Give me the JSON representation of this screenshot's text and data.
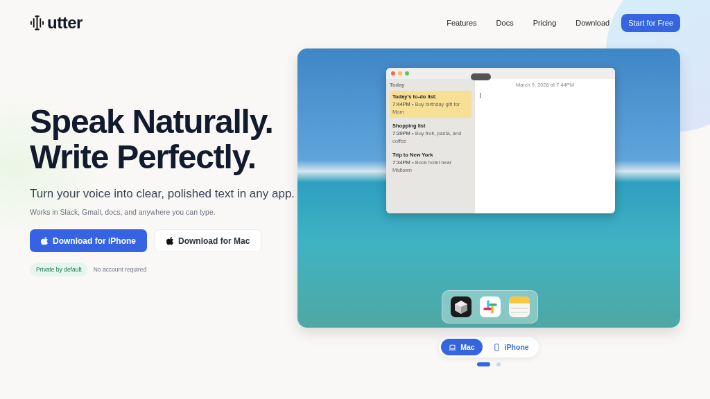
{
  "header": {
    "brand": "utter",
    "nav": [
      {
        "label": "Features"
      },
      {
        "label": "Docs"
      },
      {
        "label": "Pricing"
      },
      {
        "label": "Download"
      }
    ],
    "cta": "Start for Free"
  },
  "hero": {
    "title_lines": [
      "Speak Naturally.",
      "Write Perfectly."
    ],
    "subtitle": "Turn your voice into clear, polished text in any app.",
    "note": "Works in Slack, Gmail, docs, and anywhere you can type.",
    "buttons": [
      {
        "label": "Download for iPhone",
        "kind": "primary"
      },
      {
        "label": "Download for Mac",
        "kind": "secondary"
      }
    ],
    "badge": "Private by default",
    "badge_note": "No account required"
  },
  "showcase": {
    "notes_window": {
      "sidebar_heading": "Today",
      "date": "March 9, 2026 at 7:44PM",
      "notes": [
        {
          "title": "Today's to-do list:",
          "time": "7:44PM",
          "preview": "• Buy birthday gift for Mom",
          "selected": true
        },
        {
          "title": "Shopping list",
          "time": "7:39PM",
          "preview": "• Buy fruit, pasta, and coffee",
          "selected": false
        },
        {
          "title": "Trip to New York",
          "time": "7:34PM",
          "preview": "• Book hotel near Midtown",
          "selected": false
        }
      ]
    },
    "platforms": [
      {
        "label": "Mac",
        "kind": "laptop",
        "selected": true
      },
      {
        "label": "iPhone",
        "kind": "phone",
        "selected": false
      }
    ],
    "slides": [
      {
        "selected": true
      },
      {
        "selected": false
      }
    ]
  }
}
